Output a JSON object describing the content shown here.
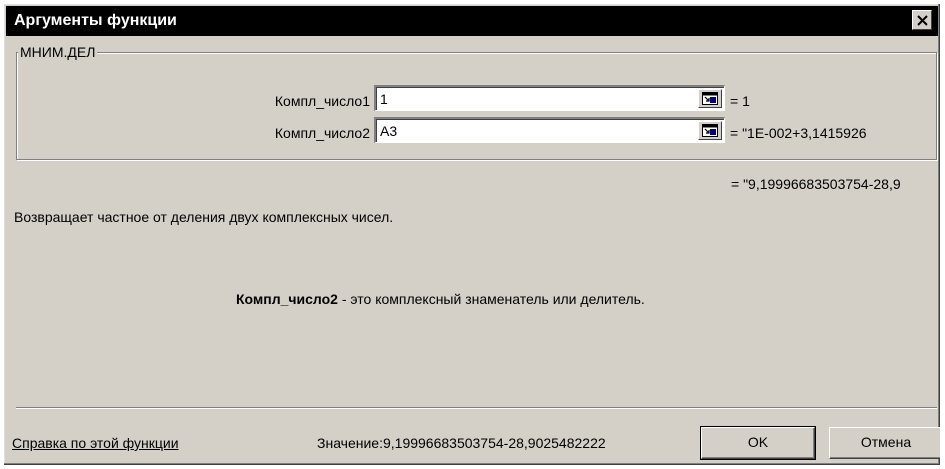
{
  "window": {
    "title": "Аргументы функции",
    "close_glyph": "x"
  },
  "function_group": {
    "name": "МНИМ.ДЕЛ",
    "args": [
      {
        "label": "Компл_число1",
        "value": "1",
        "result": "= 1"
      },
      {
        "label": "Компл_число2",
        "value": "A3",
        "result": "= \"1E-002+3,1415926"
      }
    ]
  },
  "overall_result": "= \"9,19996683503754-28,9",
  "description": "Возвращает частное от деления двух комплексных чисел.",
  "arg_help": {
    "name": "Компл_число2",
    "text": " - это комплексный знаменатель или делитель."
  },
  "footer": {
    "help_link": "Справка по этой функции",
    "value_label": "Значение:",
    "value": "9,19996683503754-28,9025482222",
    "ok_label": "OK",
    "cancel_label": "Отмена"
  },
  "icons": {
    "collapse": "collapse-dialog-icon",
    "close": "close-icon"
  }
}
